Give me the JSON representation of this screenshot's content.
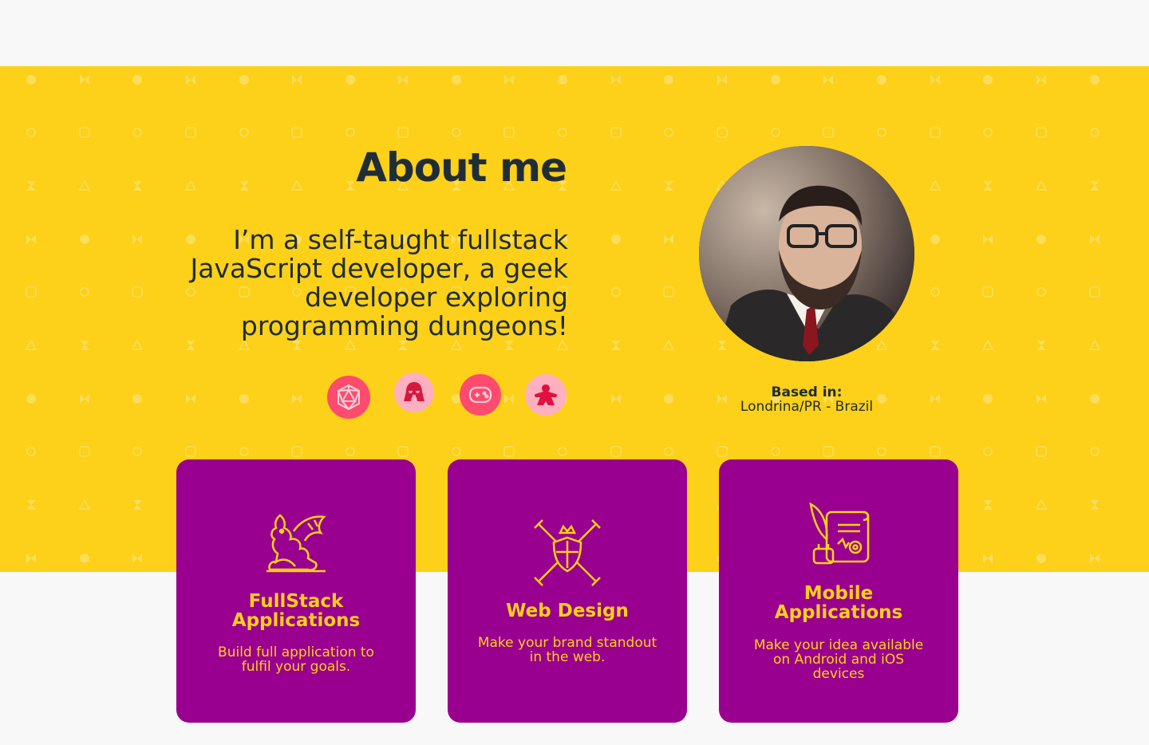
{
  "about": {
    "title": "About me",
    "bio": "I’m a self-taught fullstack JavaScript developer, a geek developer exploring programming dungeons!"
  },
  "hobbies": [
    {
      "icon": "d20-dice-icon",
      "bg": "#ff4b6e"
    },
    {
      "icon": "darth-vader-icon",
      "bg": "#ffb0c0"
    },
    {
      "icon": "gamepad-icon",
      "bg": "#ff4b6e"
    },
    {
      "icon": "meeple-icon",
      "bg": "#ffb0c0"
    }
  ],
  "location": {
    "label": "Based in:",
    "value": "Londrina/PR - Brazil"
  },
  "services": [
    {
      "icon": "dragon-icon",
      "title_line1": "FullStack",
      "title_line2": "Applications",
      "desc_line1": "Build full application to",
      "desc_line2": "fulfil your goals."
    },
    {
      "icon": "crossed-swords-shield-icon",
      "title": "Web Design",
      "desc_line1": "Make your brand standout",
      "desc_line2": "in the web."
    },
    {
      "icon": "scroll-quill-icon",
      "title_line1": "Mobile",
      "title_line2": "Applications",
      "desc_line1": "Make your idea available",
      "desc_line2": "on Android and iOS",
      "desc_line3": "devices"
    }
  ],
  "colors": {
    "yellow": "#fdd01a",
    "purple": "#9a008f",
    "dark": "#1f2d36",
    "pink": "#ff4b6e",
    "light_pink": "#ffb0c0"
  }
}
